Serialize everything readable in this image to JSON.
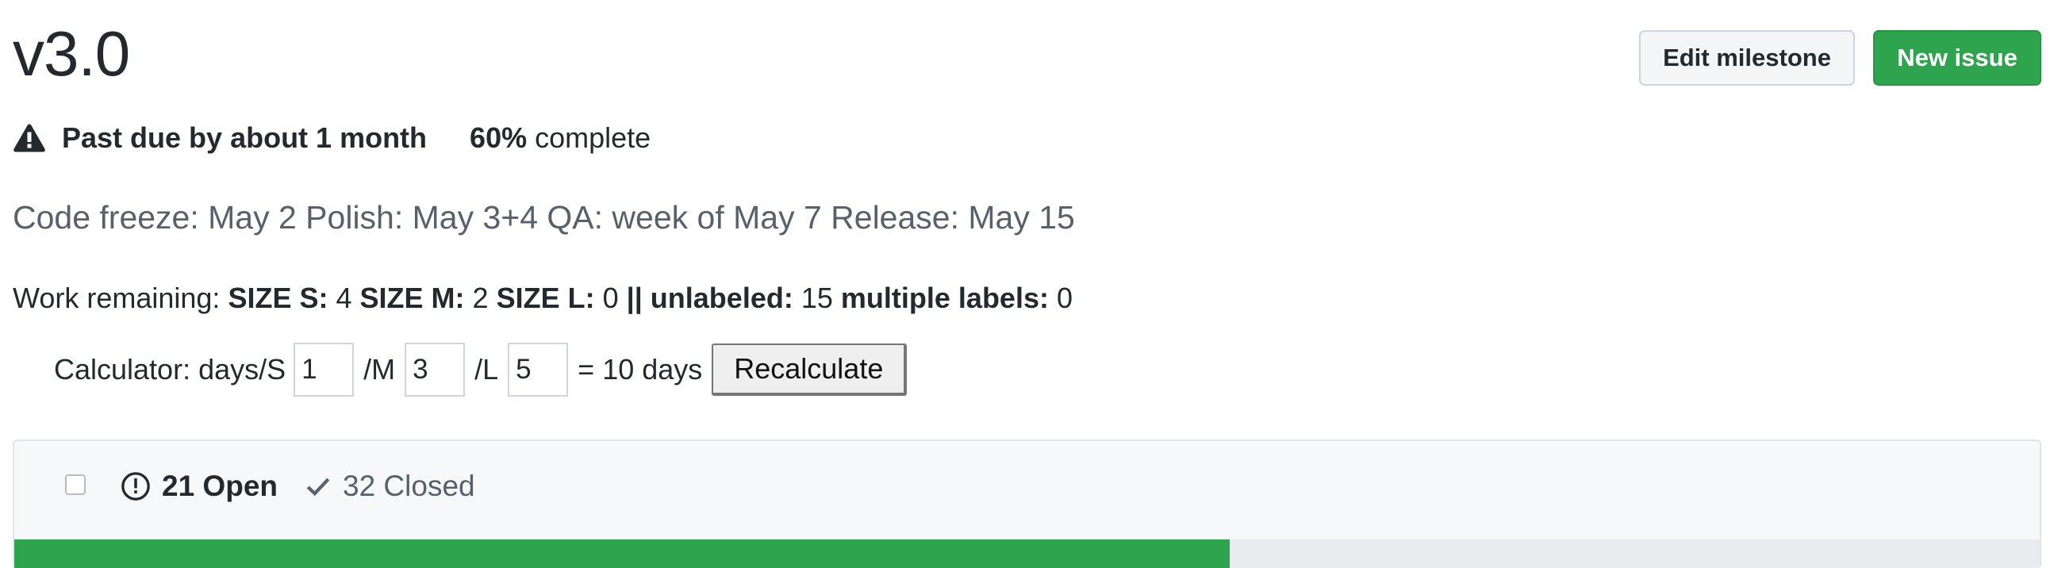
{
  "milestone": {
    "title": "v3.0",
    "edit_label": "Edit milestone",
    "new_issue_label": "New issue",
    "status_text": "Past due by about 1 month",
    "percent_label": "60%",
    "complete_label": "complete",
    "description": "Code freeze: May 2 Polish: May 3+4 QA: week of May 7 Release: May 15"
  },
  "work": {
    "prefix": "Work remaining:",
    "size_s_label": "SIZE S:",
    "size_s_value": "4",
    "size_m_label": "SIZE M:",
    "size_m_value": "2",
    "size_l_label": "SIZE L:",
    "size_l_value": "0",
    "unlabeled_label": "|| unlabeled:",
    "unlabeled_value": "15",
    "multiple_label": "multiple labels:",
    "multiple_value": "0"
  },
  "calculator": {
    "prefix": "Calculator: days/S",
    "s_value": "1",
    "m_label": "/M",
    "m_value": "3",
    "l_label": "/L",
    "l_value": "5",
    "result": "= 10 days",
    "button_label": "Recalculate"
  },
  "issues": {
    "open_label": "21 Open",
    "closed_label": "32 Closed",
    "progress_fraction": 0.6
  },
  "colors": {
    "accent_green": "#2ea44f",
    "muted_text": "#586069"
  },
  "icons": [
    "alert-icon",
    "issue-opened-icon",
    "check-icon"
  ]
}
